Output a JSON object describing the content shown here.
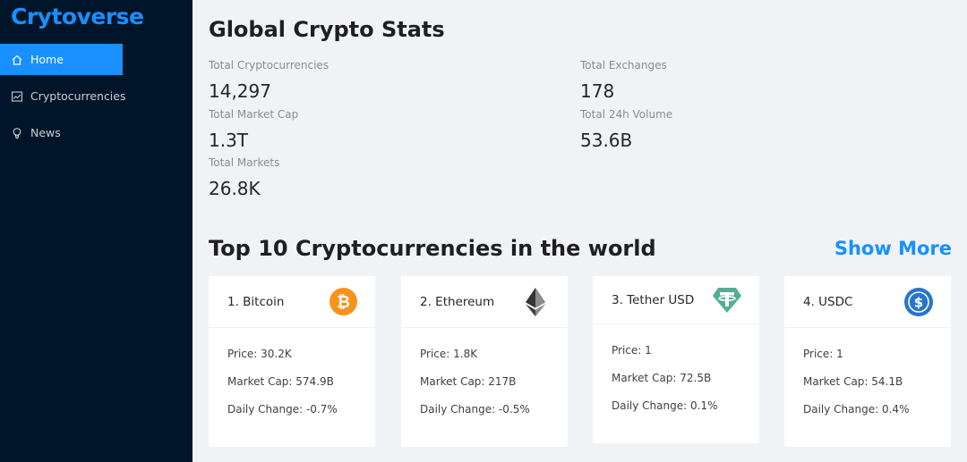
{
  "app": {
    "logo": "Crytoverse"
  },
  "sidebar": {
    "items": [
      {
        "label": "Home",
        "icon": "home-icon",
        "active": true
      },
      {
        "label": "Cryptocurrencies",
        "icon": "line-chart-icon",
        "active": false
      },
      {
        "label": "News",
        "icon": "bulb-icon",
        "active": false
      }
    ]
  },
  "stats": {
    "title": "Global Crypto Stats",
    "items": [
      {
        "label": "Total Cryptocurrencies",
        "value": "14,297"
      },
      {
        "label": "Total Exchanges",
        "value": "178"
      },
      {
        "label": "Total Market Cap",
        "value": "1.3T"
      },
      {
        "label": "Total 24h Volume",
        "value": "53.6B"
      },
      {
        "label": "Total Markets",
        "value": "26.8K"
      }
    ]
  },
  "top": {
    "title": "Top 10 Cryptocurrencies in the world",
    "show_more": "Show More",
    "cards": [
      {
        "title": "1. Bitcoin",
        "price": "Price: 30.2K",
        "market_cap": "Market Cap: 574.9B",
        "change": "Daily Change: -0.7%",
        "icon": "bitcoin-icon",
        "color": "#f7931a"
      },
      {
        "title": "2. Ethereum",
        "price": "Price: 1.8K",
        "market_cap": "Market Cap: 217B",
        "change": "Daily Change: -0.5%",
        "icon": "ethereum-icon",
        "color": "#343434"
      },
      {
        "title": "3. Tether USD",
        "price": "Price: 1",
        "market_cap": "Market Cap: 72.5B",
        "change": "Daily Change: 0.1%",
        "icon": "tether-icon",
        "color": "#50af95"
      },
      {
        "title": "4. USDC",
        "price": "Price: 1",
        "market_cap": "Market Cap: 54.1B",
        "change": "Daily Change: 0.4%",
        "icon": "usdc-icon",
        "color": "#2775ca"
      }
    ]
  }
}
